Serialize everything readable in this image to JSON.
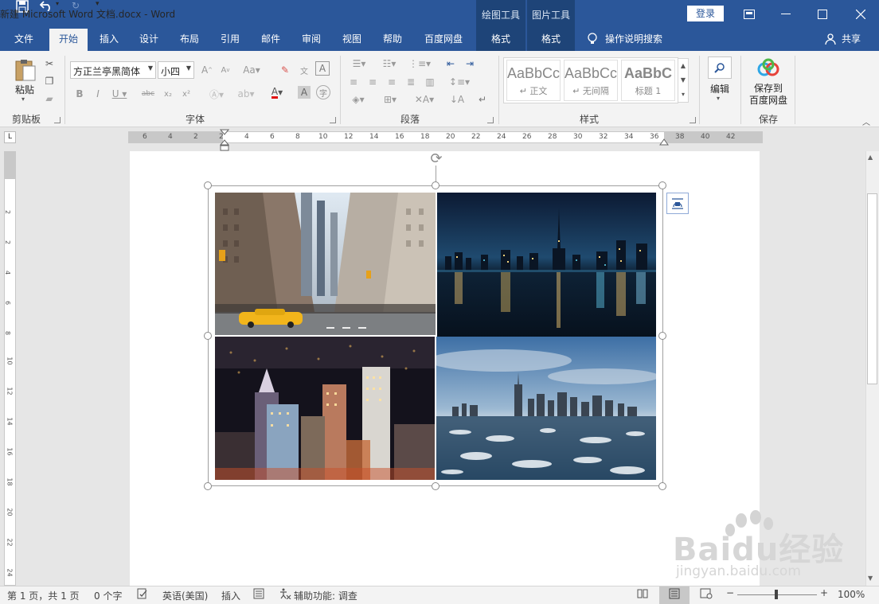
{
  "titlebar": {
    "doc_title": "新建 Microsoft Word 文档.docx  -  Word",
    "context_tabs": [
      "绘图工具",
      "图片工具"
    ],
    "login": "登录",
    "quick_access": [
      "save-icon",
      "undo-icon",
      "redo-icon",
      "customize-icon"
    ]
  },
  "tabs": {
    "file": "文件",
    "home": "开始",
    "insert": "插入",
    "design": "设计",
    "layout": "布局",
    "references": "引用",
    "mailings": "邮件",
    "review": "审阅",
    "view": "视图",
    "help": "帮助",
    "baidu": "百度网盘",
    "format1": "格式",
    "format2": "格式",
    "tell_me": "操作说明搜索",
    "share": "共享"
  },
  "ribbon": {
    "clipboard": {
      "paste": "粘贴",
      "label": "剪贴板"
    },
    "font": {
      "name": "方正兰亭黑简体",
      "size": "小四",
      "label": "字体"
    },
    "paragraph": {
      "label": "段落"
    },
    "styles": {
      "label": "样式",
      "items": [
        {
          "preview": "AaBbCcDc",
          "name": "↵ 正文"
        },
        {
          "preview": "AaBbCcDc",
          "name": "↵ 无间隔"
        },
        {
          "preview": "AaBbC",
          "name": "标题 1"
        }
      ]
    },
    "editing": {
      "label": "编辑"
    },
    "save": {
      "button": "保存到\n百度网盘",
      "label": "保存"
    }
  },
  "ruler": {
    "h_numbers": [
      "6",
      "4",
      "2",
      "2",
      "4",
      "6",
      "8",
      "10",
      "12",
      "14",
      "16",
      "18",
      "20",
      "22",
      "24",
      "26",
      "28",
      "30",
      "32",
      "34",
      "36",
      "38",
      "40",
      "42"
    ],
    "v_numbers": [
      "2",
      "2",
      "4",
      "6",
      "8",
      "10",
      "12",
      "14",
      "16",
      "18",
      "20",
      "22",
      "24"
    ]
  },
  "images": [
    {
      "name": "city-street-photo",
      "desc": "city street with taxi"
    },
    {
      "name": "night-skyline-reflection-photo",
      "desc": "night skyline reflection"
    },
    {
      "name": "city-night-aerial-photo",
      "desc": "city at night"
    },
    {
      "name": "skyline-ice-water-photo",
      "desc": "skyline over icy water"
    }
  ],
  "status": {
    "page": "第 1 页，共 1 页",
    "words": "0 个字",
    "language": "英语(美国)",
    "mode": "插入",
    "accessibility": "辅助功能: 调查",
    "zoom": "100%"
  },
  "watermark": {
    "brand": "Baidu经验",
    "url": "jingyan.baidu.com"
  }
}
